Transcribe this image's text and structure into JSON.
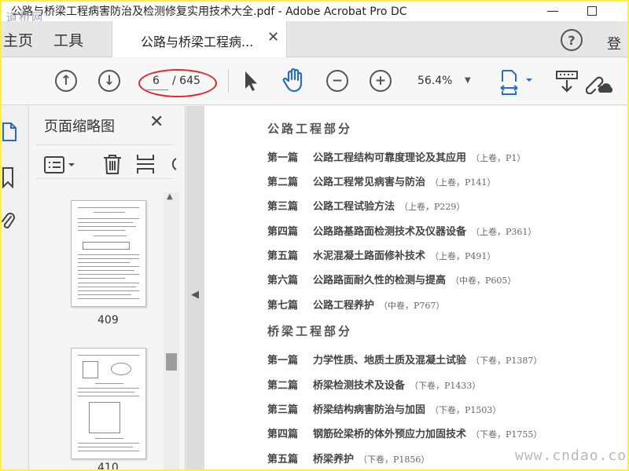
{
  "window": {
    "title": "公路与桥梁工程病害防治及检测修复实用技术大全.pdf - Adobe Acrobat Pro DC",
    "watermark_top": "道桥网",
    "minimize_glyph": "—",
    "close_glyph": "✕"
  },
  "tabs": {
    "home": "主页",
    "tools": "工具",
    "document": "公路与桥梁工程病...",
    "document_close": "✕"
  },
  "header": {
    "help_glyph": "?",
    "login": "登"
  },
  "toolbar": {
    "current_page": "6",
    "total_pages": "/ 645",
    "zoom": "56.4%",
    "zoom_caret": "▼",
    "prev_glyph": "↑",
    "next_glyph": "↓",
    "zoom_out_glyph": "−",
    "zoom_in_glyph": "+"
  },
  "thumbnails_panel": {
    "title": "页面缩略图",
    "close": "✕",
    "thumbnails": [
      {
        "page": "409"
      },
      {
        "page": "410"
      }
    ]
  },
  "document": {
    "sections": [
      {
        "title": "公路工程部分",
        "entries": [
          {
            "part": "第一篇",
            "name": "公路工程结构可靠度理论及其应用",
            "ref": "（上卷，P1）"
          },
          {
            "part": "第二篇",
            "name": "公路工程常见病害与防治",
            "ref": "（上卷，P141）"
          },
          {
            "part": "第三篇",
            "name": "公路工程试验方法",
            "ref": "（上卷，P229）"
          },
          {
            "part": "第四篇",
            "name": "公路路基路面检测技术及仪器设备",
            "ref": "（上卷，P361）"
          },
          {
            "part": "第五篇",
            "name": "水泥混凝土路面修补技术",
            "ref": "（上卷，P491）"
          },
          {
            "part": "第六篇",
            "name": "公路路面耐久性的检测与提高",
            "ref": "（中卷，P605）"
          },
          {
            "part": "第七篇",
            "name": "公路工程养护",
            "ref": "（中卷，P767）"
          }
        ]
      },
      {
        "title": "桥梁工程部分",
        "entries": [
          {
            "part": "第一篇",
            "name": "力学性质、地质土质及混凝土试验",
            "ref": "（下卷，P1387）"
          },
          {
            "part": "第二篇",
            "name": "桥梁检测技术及设备",
            "ref": "（下卷，P1433）"
          },
          {
            "part": "第三篇",
            "name": "桥梁结构病害防治与加固",
            "ref": "（下卷，P1503）"
          },
          {
            "part": "第四篇",
            "name": "钢筋砼梁桥的体外预应力加固技术",
            "ref": "（下卷，P1755）"
          },
          {
            "part": "第五篇",
            "name": "桥梁养护",
            "ref": "（下卷，P1856）"
          }
        ]
      }
    ],
    "watermark_bottom": "www.cndao.com"
  },
  "colors": {
    "annotation_ellipse": "#e0252c",
    "accent_blue": "#2a6ebb"
  }
}
